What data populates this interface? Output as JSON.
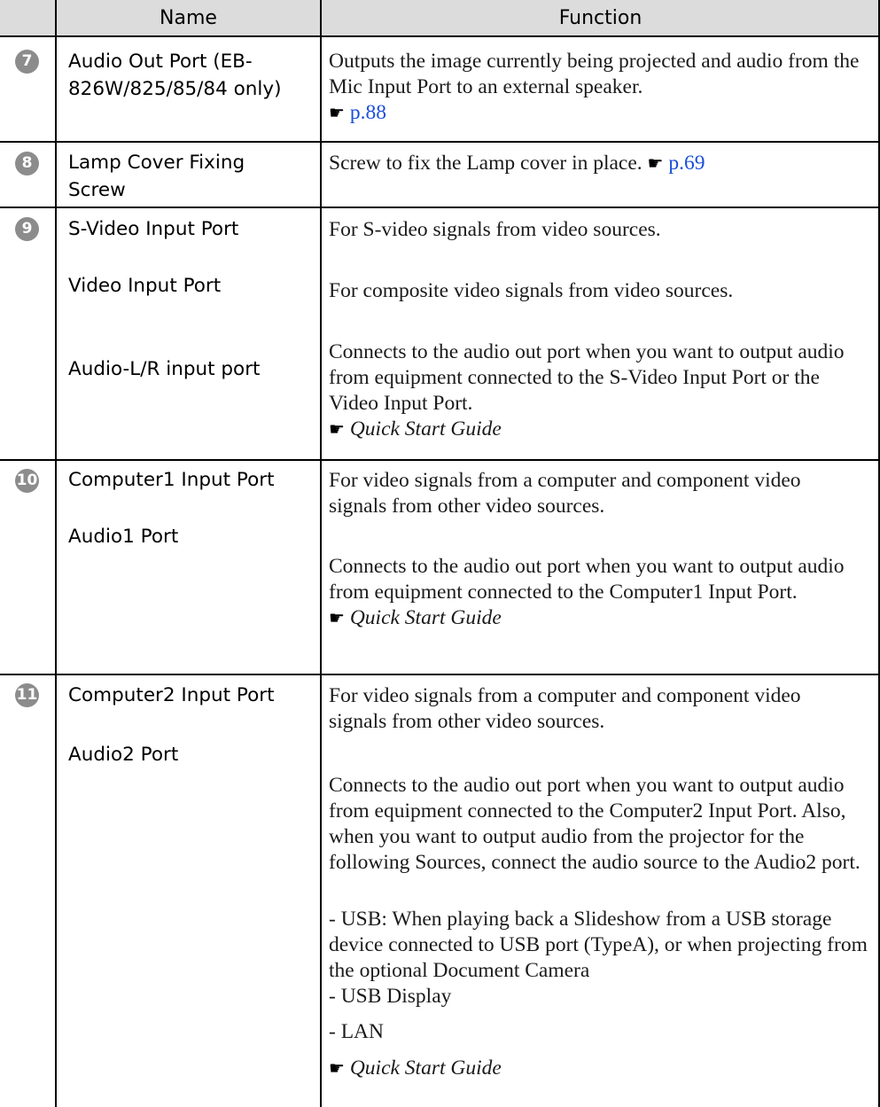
{
  "header": {
    "name": "Name",
    "function": "Function"
  },
  "pointer_glyph": "☛",
  "rows": [
    {
      "number": "7",
      "names": [
        "Audio Out Port (EB-826W/825/85/84 only)"
      ],
      "descriptions": [
        {
          "text": "Outputs the image currently being projected and audio from the Mic Input Port to an external speaker.",
          "ref": "p.88"
        }
      ]
    },
    {
      "number": "8",
      "names": [
        "Lamp Cover Fixing Screw"
      ],
      "descriptions": [
        {
          "text": "Screw to fix the Lamp cover in place.",
          "ref": "p.69"
        }
      ]
    },
    {
      "number": "9",
      "names": [
        "S-Video Input Port",
        "Video Input Port",
        "Audio-L/R input port"
      ],
      "descriptions": [
        {
          "text": "For S-video signals from video sources."
        },
        {
          "text": "For composite video signals from video sources."
        },
        {
          "text": "Connects to the audio out port when you want to output audio from equipment connected to the S-Video Input Port or the Video Input Port.",
          "guide": "Quick Start Guide"
        }
      ]
    },
    {
      "number": "10",
      "names": [
        "Computer1 Input Port",
        "Audio1 Port"
      ],
      "descriptions": [
        {
          "text": "For video signals from a computer and component video signals from other video sources."
        },
        {
          "text": "Connects to the audio out port when you want to output audio from equipment connected to the Computer1 Input Port.",
          "guide": "Quick Start Guide"
        }
      ]
    },
    {
      "number": "11",
      "names": [
        "Computer2 Input Port",
        "Audio2 Port"
      ],
      "descriptions": [
        {
          "text": "For video signals from a computer and component video signals from other video sources."
        },
        {
          "text": "Connects to the audio out port when you want to output audio from equipment connected to the Computer2 Input Port. Also, when you want to output audio from the projector for the following Sources, connect the audio source to the Audio2 port."
        },
        {
          "text": "- USB: When playing back a Slideshow from a USB storage device connected to USB port (TypeA), or when projecting from the optional Document Camera"
        },
        {
          "text": "- USB Display"
        },
        {
          "text": "- LAN"
        },
        {
          "guide": "Quick Start Guide"
        }
      ]
    }
  ]
}
